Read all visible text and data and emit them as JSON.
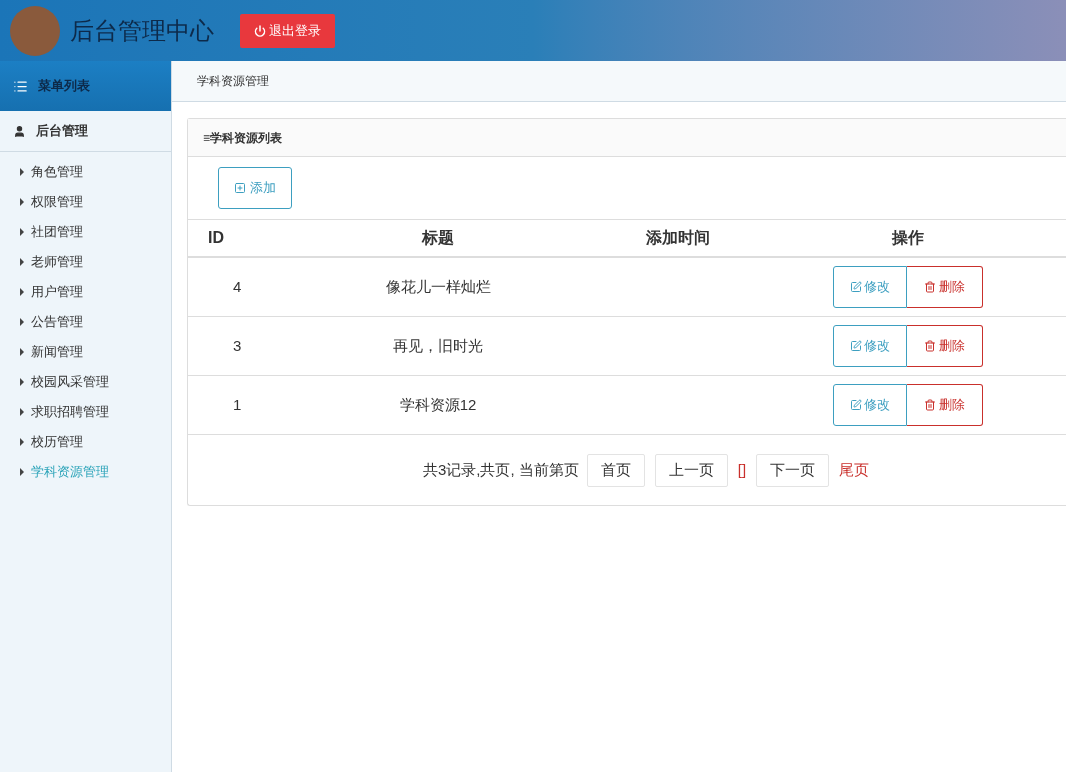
{
  "header": {
    "title": "后台管理中心",
    "logout": "退出登录"
  },
  "sidebar": {
    "menu_title": "菜单列表",
    "section": "后台管理",
    "items": [
      {
        "label": "角色管理",
        "selected": false
      },
      {
        "label": "权限管理",
        "selected": false
      },
      {
        "label": "社团管理",
        "selected": false
      },
      {
        "label": "老师管理",
        "selected": false
      },
      {
        "label": "用户管理",
        "selected": false
      },
      {
        "label": "公告管理",
        "selected": false
      },
      {
        "label": "新闻管理",
        "selected": false
      },
      {
        "label": "校园风采管理",
        "selected": false
      },
      {
        "label": "求职招聘管理",
        "selected": false
      },
      {
        "label": "校历管理",
        "selected": false
      },
      {
        "label": "学科资源管理",
        "selected": true
      }
    ]
  },
  "breadcrumb": "学科资源管理",
  "panel": {
    "title": "≡学科资源列表",
    "add_button": "添加"
  },
  "table": {
    "columns": [
      "ID",
      "标题",
      "添加时间",
      "操作"
    ],
    "rows": [
      {
        "id": "4",
        "title": "像花儿一样灿烂",
        "edit": "修改",
        "delete": "删除"
      },
      {
        "id": "3",
        "title": "再见，旧时光",
        "edit": "修改",
        "delete": "删除"
      },
      {
        "id": "1",
        "title": "学科资源12",
        "edit": "修改",
        "delete": "删除"
      }
    ]
  },
  "pagination": {
    "summary": "共3记录,共页, 当前第页",
    "items": [
      {
        "kind": "button",
        "label": "首页"
      },
      {
        "kind": "button",
        "label": "上一页"
      },
      {
        "kind": "current",
        "label": "[]"
      },
      {
        "kind": "button",
        "label": "下一页"
      },
      {
        "kind": "link",
        "label": "尾页"
      }
    ]
  }
}
